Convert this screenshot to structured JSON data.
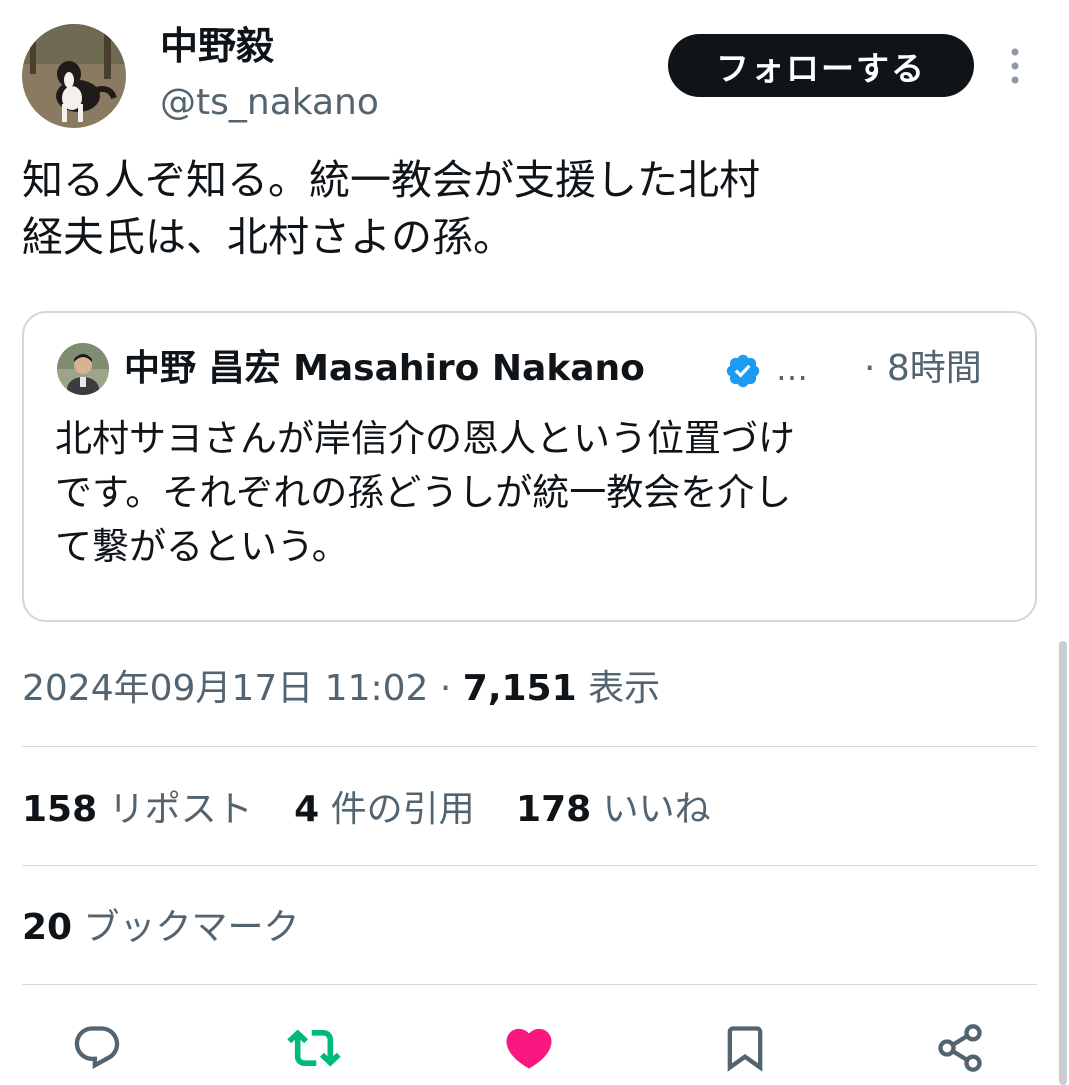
{
  "author": {
    "display_name": "中野毅",
    "handle": "@ts_nakano"
  },
  "follow_button_label": "フォローする",
  "tweet": {
    "text": "知る人ぞ知る。統一教会が支援した北村\n経夫氏は、北村さよの孫。"
  },
  "quote": {
    "author_name": "中野 昌宏 Masahiro Nakano",
    "ellipsis": "…",
    "time": "· 8時間",
    "text": "北村サヨさんが岸信介の恩人という位置づけ\nです。それぞれの孫どうしが統一教会を介し\nて繋がるという。"
  },
  "meta": {
    "timestamp": "2024年09月17日 11:02 · ",
    "views_count": "7,151",
    "views_label": " 表示"
  },
  "stats": {
    "reposts_count": "158",
    "reposts_label": " リポスト",
    "quotes_count": "4",
    "quotes_label": " 件の引用",
    "likes_count": "178",
    "likes_label": " いいね",
    "bookmarks_count": "20",
    "bookmarks_label": " ブックマーク"
  },
  "actions": [
    "reply-icon",
    "retweet-icon",
    "like-icon",
    "bookmark-icon",
    "share-icon"
  ],
  "colors": {
    "text": "#0f1419",
    "secondary": "#536471",
    "border": "#cfd9de",
    "retweet": "#00ba7c",
    "like": "#f91880",
    "verified": "#1d9bf0"
  }
}
